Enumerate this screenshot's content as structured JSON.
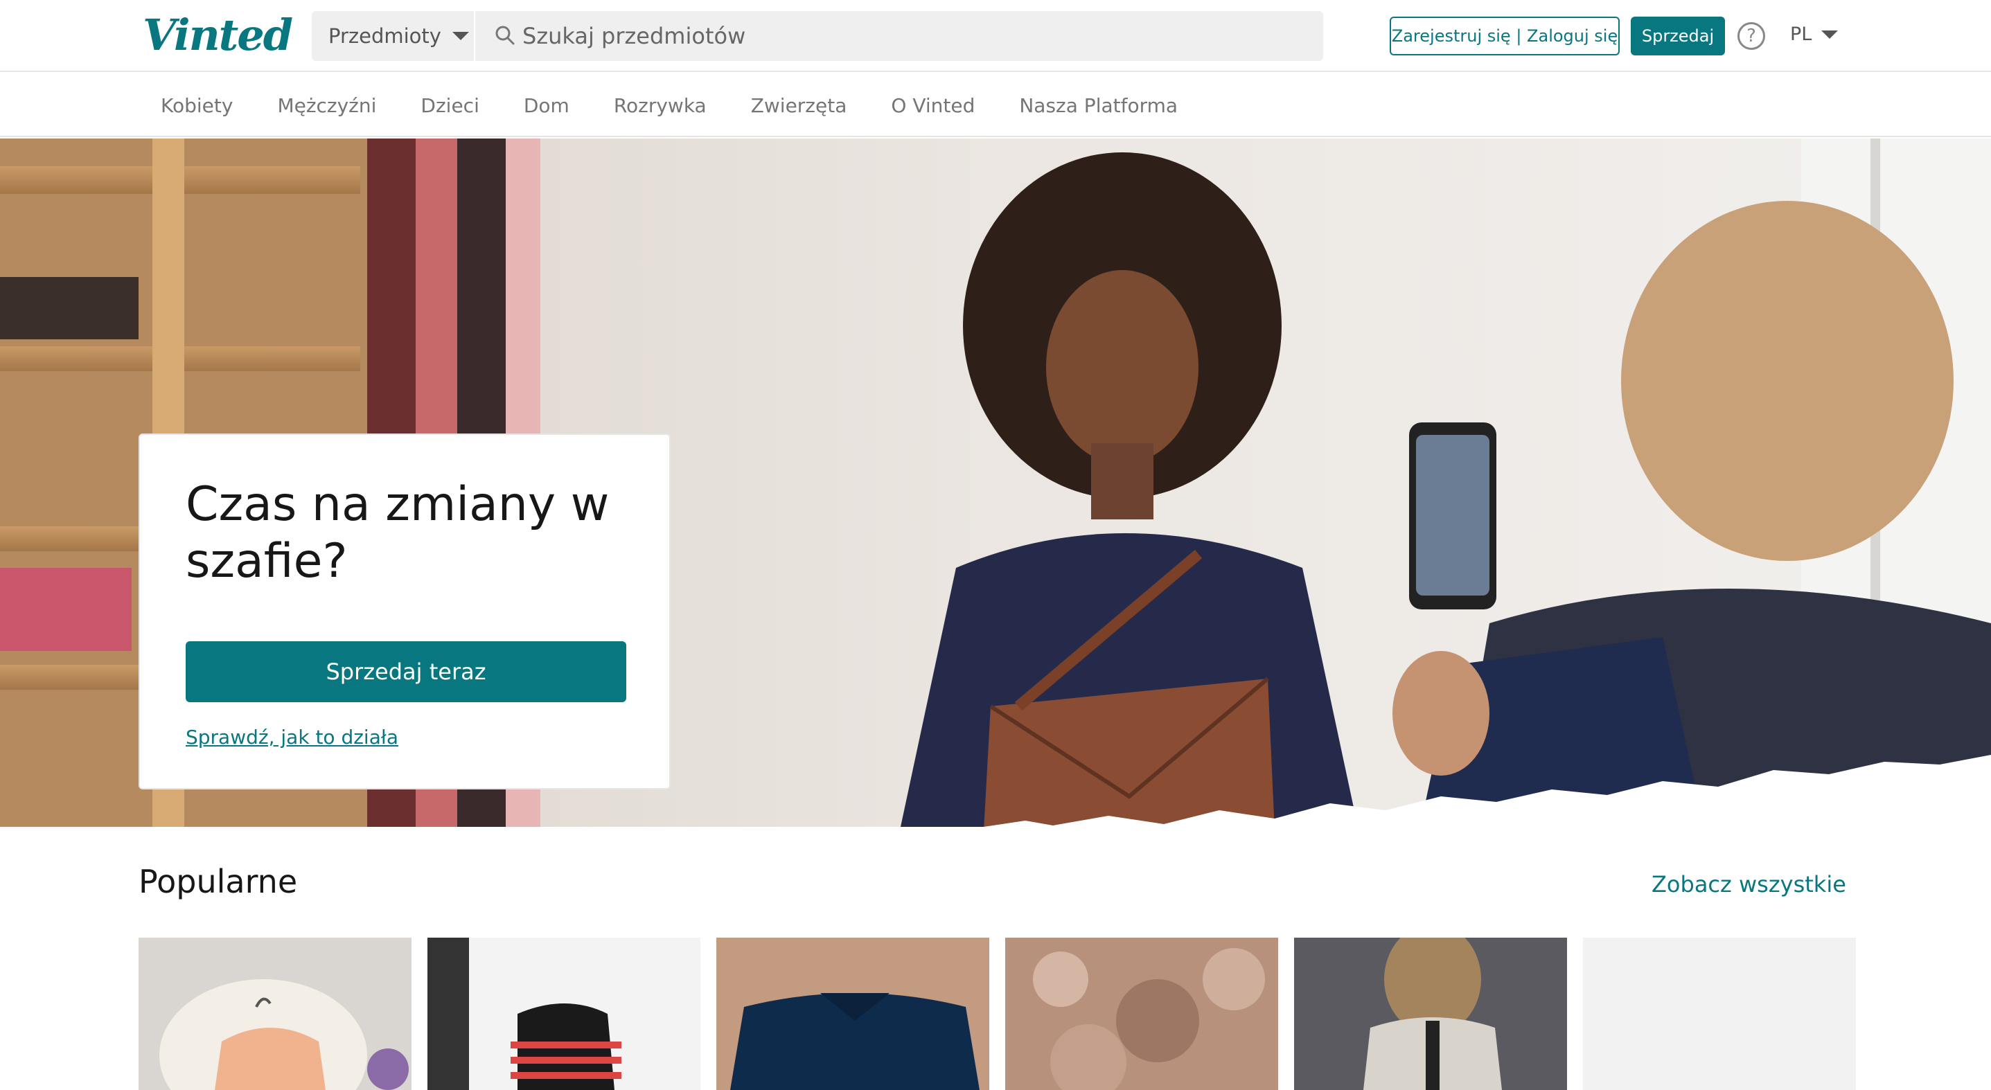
{
  "header": {
    "logo": "Vinted",
    "search": {
      "category": "Przedmioty",
      "placeholder": "Szukaj przedmiotów"
    },
    "auth_label": "Zarejestruj się | Zaloguj się",
    "sell_label": "Sprzedaj",
    "help_label": "?",
    "language": "PL"
  },
  "nav": {
    "categories": [
      "Kobiety",
      "Mężczyźni",
      "Dzieci",
      "Dom",
      "Rozrywka",
      "Zwierzęta",
      "O Vinted",
      "Nasza Platforma"
    ]
  },
  "hero": {
    "title": "Czas na zmiany w szafie?",
    "cta_label": "Sprzedaj teraz",
    "link_label": "Sprawdź, jak to działa"
  },
  "popular": {
    "title": "Popularne",
    "see_all_label": "Zobacz wszystkie"
  },
  "colors": {
    "brand": "#09777f",
    "text_muted": "#757575"
  }
}
